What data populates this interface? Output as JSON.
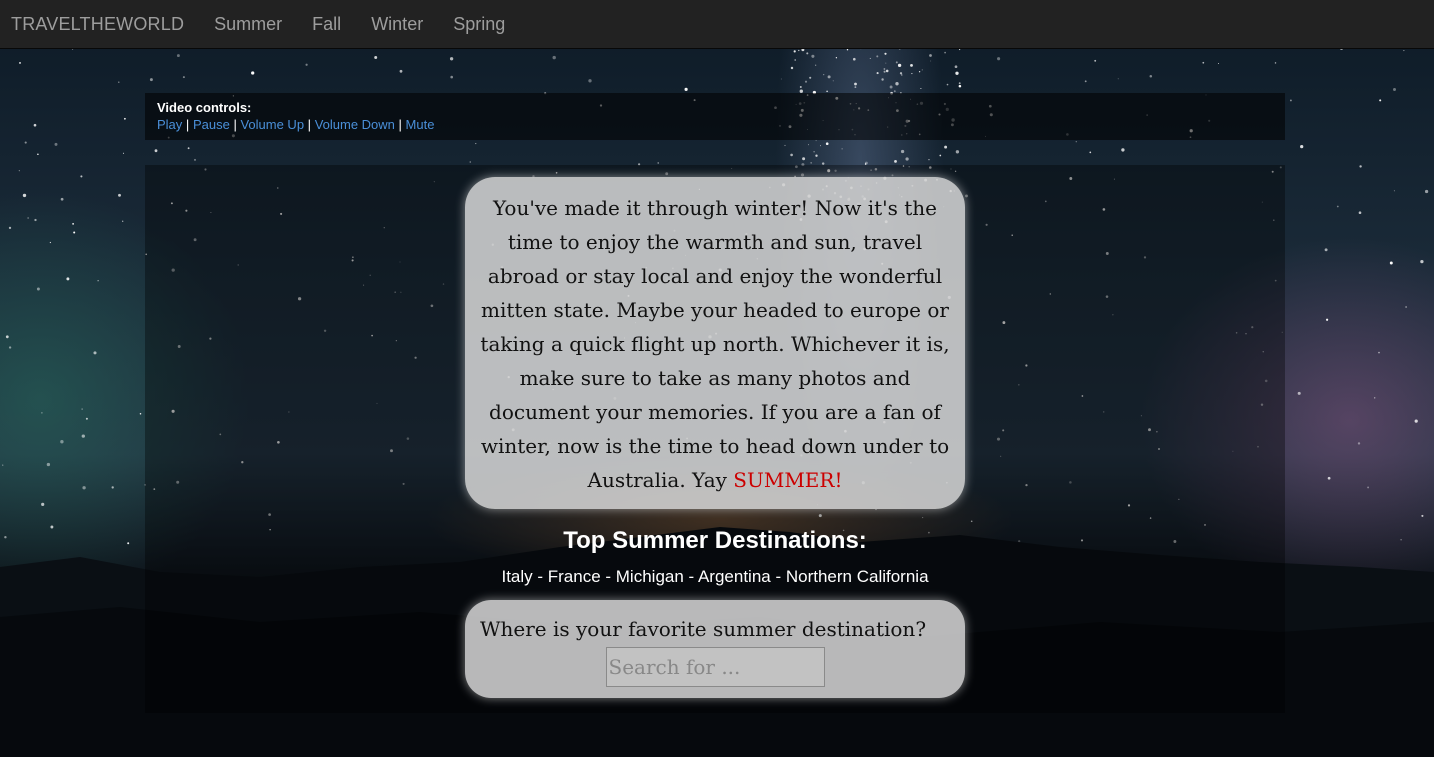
{
  "navbar": {
    "brand": "TRAVELTHEWORLD",
    "links": [
      "Summer",
      "Fall",
      "Winter",
      "Spring"
    ]
  },
  "video_controls": {
    "title": "Video controls:",
    "links": [
      "Play",
      "Pause",
      "Volume Up",
      "Volume Down",
      "Mute"
    ],
    "link_color": "#4a8fd8"
  },
  "intro": {
    "text": "You've made it through winter! Now it's the time to enjoy the warmth and sun, travel abroad or stay local and enjoy the wonderful mitten state. Maybe your headed to europe or taking a quick flight up north. Whichever it is, make sure to take as many photos and document your memories. If you are a fan of winter, now is the time to head down under to Australia. Yay",
    "highlight": "SUMMER!",
    "highlight_color": "#cc0000"
  },
  "destinations": {
    "title": "Top Summer Destinations:",
    "list": "Italy - France - Michigan - Argentina - Northern California"
  },
  "search": {
    "question": "Where is your favorite summer destination?",
    "placeholder": "Search for ..."
  }
}
